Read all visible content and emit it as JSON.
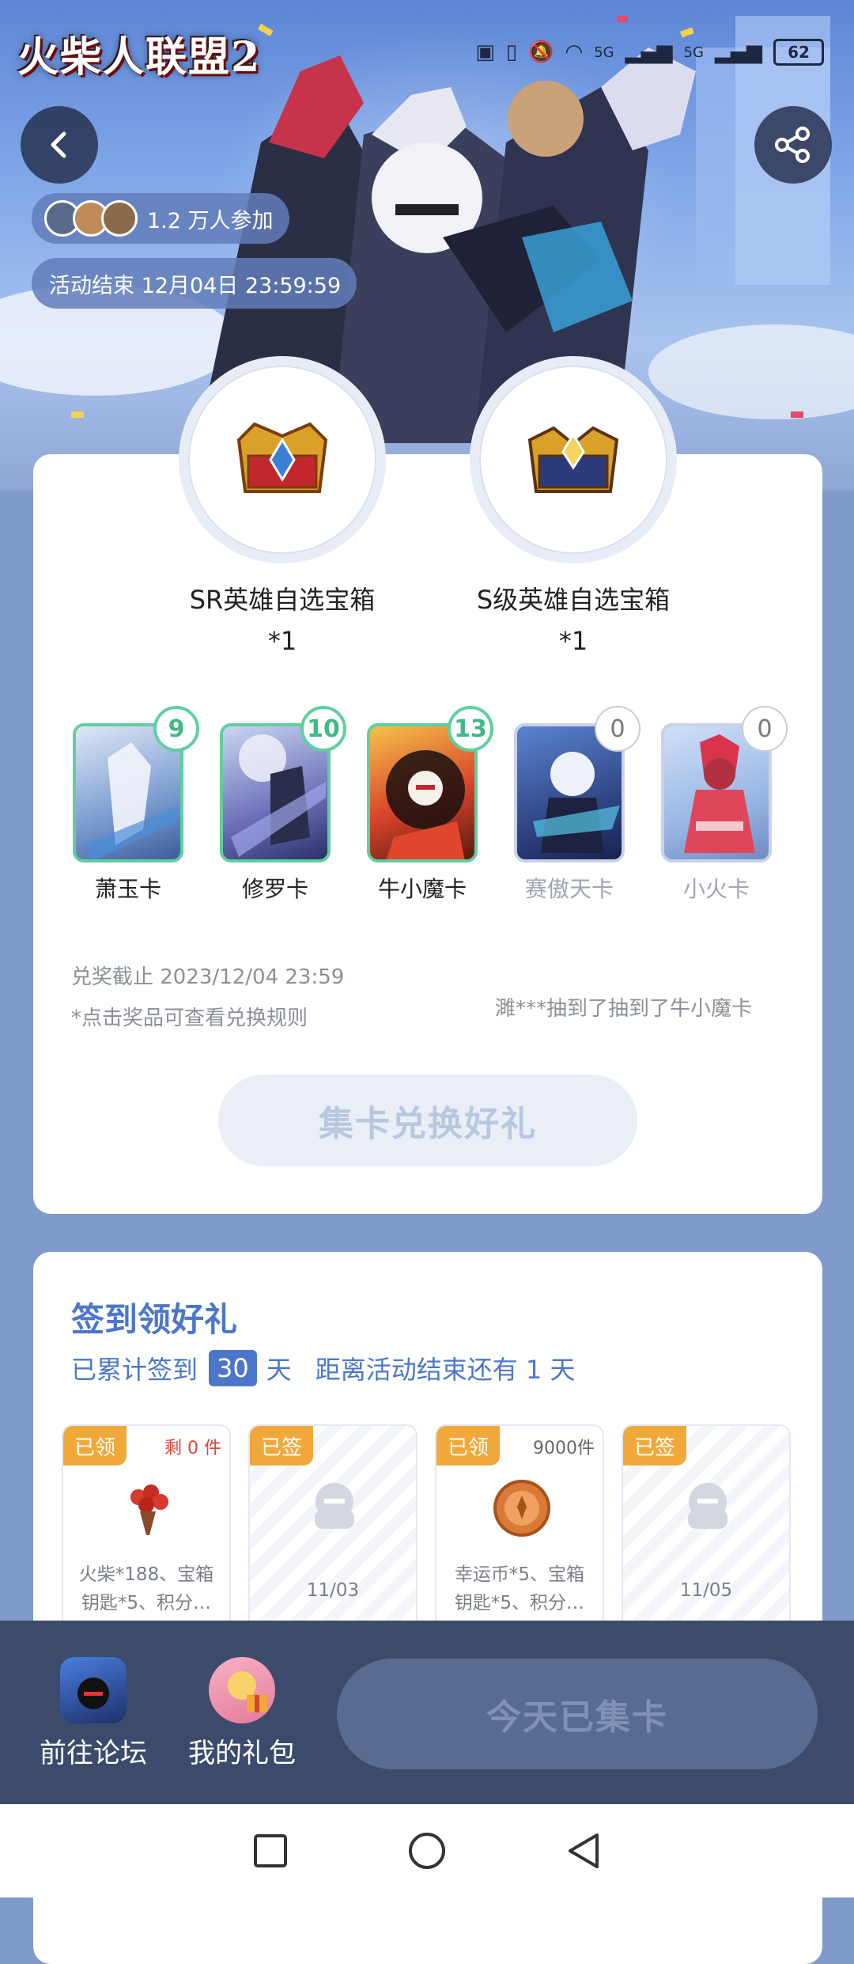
{
  "header": {
    "logo_text": "火柴人联盟2",
    "participants": "1.2 万人参加",
    "end_time": "活动结束 12月04日 23:59:59",
    "status": {
      "network1": "5G",
      "network2": "5G",
      "battery": "62"
    }
  },
  "prizes": [
    {
      "name": "SR英雄自选宝箱",
      "qty": "*1"
    },
    {
      "name": "S级英雄自选宝箱",
      "qty": "*1"
    }
  ],
  "cards": [
    {
      "label": "萧玉卡",
      "count": "9"
    },
    {
      "label": "修罗卡",
      "count": "10"
    },
    {
      "label": "牛小魔卡",
      "count": "13"
    },
    {
      "label": "赛傲天卡",
      "count": "0"
    },
    {
      "label": "小火卡",
      "count": "0"
    }
  ],
  "info": {
    "deadline": "兑奖截止 2023/12/04 23:59",
    "rule_hint": "*点击奖品可查看兑换规则",
    "ticker": "濉***抽到了抽到了牛小魔卡"
  },
  "exchange_button": "集卡兑换好礼",
  "signin": {
    "title": "签到领好礼",
    "sub_prefix": "已累计签到",
    "days": "30",
    "sub_unit": "天",
    "remaining": "距离活动结束还有 1 天",
    "tiles": [
      {
        "tag": "已领",
        "stock": "剩 0 件",
        "text": "火柴*188、宝箱钥匙*5、积分…"
      },
      {
        "tag": "已签",
        "stock": "",
        "text": "11/03"
      },
      {
        "tag": "已领",
        "stock": "9000件",
        "text": "幸运币*5、宝箱钥匙*5、积分…"
      },
      {
        "tag": "已签",
        "stock": "",
        "text": "11/05"
      }
    ]
  },
  "bottom": {
    "forum": "前往论坛",
    "gifts": "我的礼包",
    "cta": "今天已集卡"
  },
  "colors": {
    "accent": "#4c77c9",
    "badge_green": "#5fcf9f",
    "tag_orange": "#f0a83b",
    "bottom_bar": "#3c4b6b"
  }
}
